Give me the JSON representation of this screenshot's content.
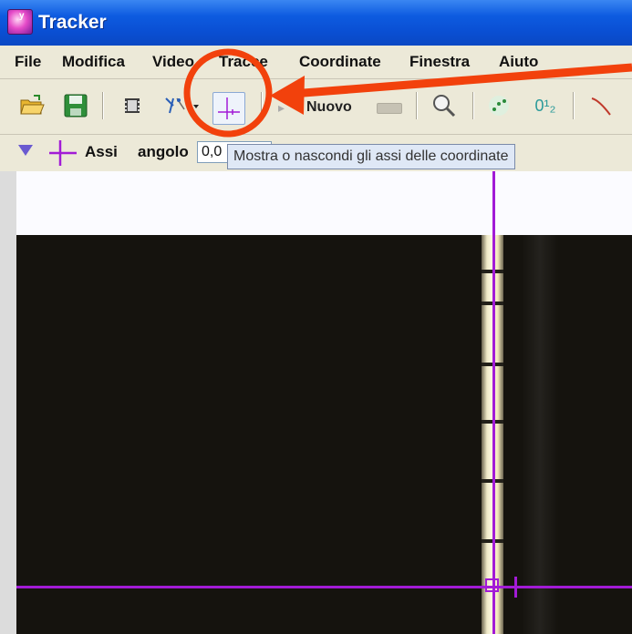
{
  "window": {
    "title": "Tracker"
  },
  "menu": {
    "items": [
      {
        "label": "File"
      },
      {
        "label": "Modifica"
      },
      {
        "label": "Video"
      },
      {
        "label": "Tracce"
      },
      {
        "label": "Coordinate"
      },
      {
        "label": "Finestra"
      },
      {
        "label": "Aiuto"
      }
    ]
  },
  "toolbar": {
    "new_label": "Nuovo",
    "buttons": [
      "open-folder-icon",
      "save-icon",
      "video-clip-icon",
      "calibration-tools-icon",
      "axes-icon",
      "new-track-icon",
      "zoom-icon",
      "autotracker-icon",
      "step-numbers-icon",
      "line-profile-icon"
    ],
    "step_numbers_label": "0¹₂"
  },
  "axes_panel": {
    "name": "Assi",
    "angle_label": "angolo",
    "angle_value": "0,0"
  },
  "tooltip": {
    "text": "Mostra o nascondi gli assi delle coordinate"
  },
  "colors": {
    "axes": "#a21bd6",
    "annotation": "#f2410c",
    "title_bar": "#0a4fd3"
  }
}
